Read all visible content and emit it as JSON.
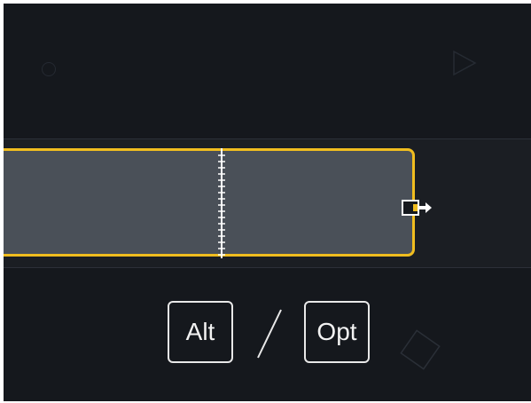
{
  "keys": {
    "alt_label": "Alt",
    "opt_label": "Opt"
  },
  "colors": {
    "background": "#15181d",
    "clip_fill": "#4a5058",
    "clip_border": "#f0bd1f",
    "key_border": "#e8e8e8"
  },
  "icons": {
    "background_shapes": [
      "circle-icon",
      "play-triangle-icon",
      "diamond-icon"
    ],
    "cursor": "trim-extend-cursor-icon"
  }
}
